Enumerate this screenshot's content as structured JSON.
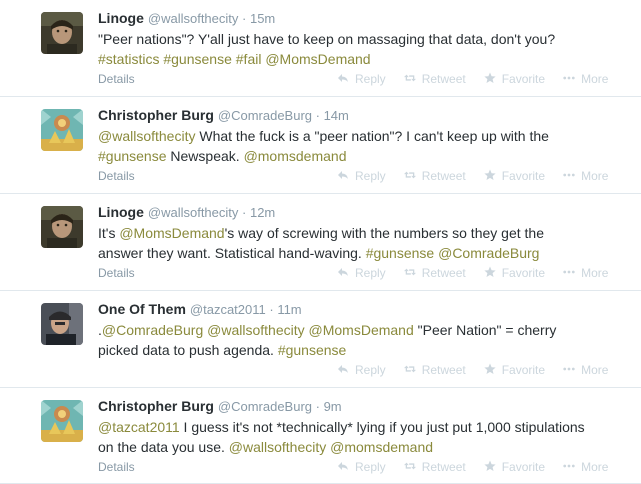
{
  "tweets": [
    {
      "fullname": "Linoge",
      "username": "@wallsofthecity",
      "time": "15m",
      "segments": [
        {
          "t": "\"Peer nations\"? Y'all just have to keep on massaging that data, don't you?",
          "link": false
        },
        {
          "t": "\n",
          "link": false
        },
        {
          "t": "#statistics",
          "link": true
        },
        {
          "t": " ",
          "link": false
        },
        {
          "t": "#gunsense",
          "link": true
        },
        {
          "t": " ",
          "link": false
        },
        {
          "t": "#fail",
          "link": true
        },
        {
          "t": " ",
          "link": false
        },
        {
          "t": "@MomsDemand",
          "link": true
        }
      ],
      "details": "Details",
      "avatar": "linoge"
    },
    {
      "fullname": "Christopher Burg",
      "username": "@ComradeBurg",
      "time": "14m",
      "segments": [
        {
          "t": "@wallsofthecity",
          "link": true
        },
        {
          "t": " What the fuck is a \"peer nation\"? I can't keep up with the",
          "link": false
        },
        {
          "t": "\n",
          "link": false
        },
        {
          "t": "#gunsense",
          "link": true
        },
        {
          "t": " Newspeak. ",
          "link": false
        },
        {
          "t": "@momsdemand",
          "link": true
        }
      ],
      "details": "Details",
      "avatar": "burg"
    },
    {
      "fullname": "Linoge",
      "username": "@wallsofthecity",
      "time": "12m",
      "segments": [
        {
          "t": "It's ",
          "link": false
        },
        {
          "t": "@MomsDemand",
          "link": true
        },
        {
          "t": "'s way of screwing with the numbers so they get the",
          "link": false
        },
        {
          "t": "\n",
          "link": false
        },
        {
          "t": "answer they want. Statistical hand-waving. ",
          "link": false
        },
        {
          "t": "#gunsense",
          "link": true
        },
        {
          "t": " ",
          "link": false
        },
        {
          "t": "@ComradeBurg",
          "link": true
        }
      ],
      "details": "Details",
      "avatar": "linoge"
    },
    {
      "fullname": "One Of Them",
      "username": "@tazcat2011",
      "time": "11m",
      "segments": [
        {
          "t": ".",
          "link": false
        },
        {
          "t": "@ComradeBurg",
          "link": true
        },
        {
          "t": " ",
          "link": false
        },
        {
          "t": "@wallsofthecity",
          "link": true
        },
        {
          "t": " ",
          "link": false
        },
        {
          "t": "@MomsDemand",
          "link": true
        },
        {
          "t": " \"Peer  Nation\" = cherry",
          "link": false
        },
        {
          "t": "\n",
          "link": false
        },
        {
          "t": "picked data to push agenda. ",
          "link": false
        },
        {
          "t": "#gunsense",
          "link": true
        }
      ],
      "details": "",
      "avatar": "tazcat"
    },
    {
      "fullname": "Christopher Burg",
      "username": "@ComradeBurg",
      "time": "9m",
      "segments": [
        {
          "t": "@tazcat2011",
          "link": true
        },
        {
          "t": " I guess it's not *technically* lying if you just put 1,000 stipulations",
          "link": false
        },
        {
          "t": "\n",
          "link": false
        },
        {
          "t": "on the data you use. ",
          "link": false
        },
        {
          "t": "@wallsofthecity",
          "link": true
        },
        {
          "t": " ",
          "link": false
        },
        {
          "t": "@momsdemand",
          "link": true
        }
      ],
      "details": "Details",
      "avatar": "burg"
    }
  ],
  "actions": {
    "reply": "Reply",
    "retweet": "Retweet",
    "favorite": "Favorite",
    "more": "More"
  },
  "colors": {
    "link": "#8a8a3c",
    "muted": "#8899a6",
    "action": "#ccd6dd",
    "divider": "#e1e8ed"
  }
}
